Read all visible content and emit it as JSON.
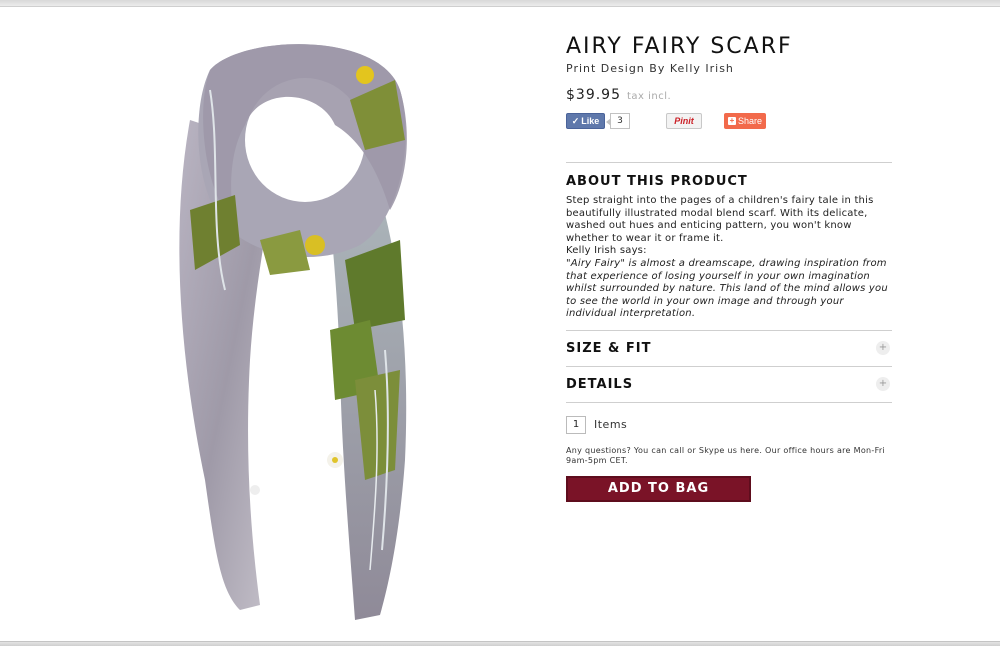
{
  "product": {
    "title": "AIRY FAIRY SCARF",
    "designer": "Print Design By Kelly Irish",
    "price": "$39.95",
    "tax_note": "tax incl."
  },
  "social": {
    "like_label": "Like",
    "like_count": "3",
    "pin_label": "Pinit",
    "share_label": "Share"
  },
  "about": {
    "heading": "ABOUT THIS PRODUCT",
    "description": "Step straight into the pages of a children's fairy tale in this beautifully illustrated modal blend scarf. With its delicate, washed out hues and enticing pattern, you won't know whether to wear it or frame it.",
    "says": "Kelly Irish says:",
    "quote": "\"Airy Fairy\" is almost a dreamscape, drawing inspiration from that experience of losing yourself in your own imagination whilst surrounded by nature. This land of the mind allows you to see the world in your own image and through your individual interpretation."
  },
  "accordions": {
    "size_fit": "SIZE & FIT",
    "details": "DETAILS"
  },
  "purchase": {
    "quantity": "1",
    "items_label": "Items",
    "questions": "Any questions? You can call or Skype us here. Our office hours are Mon-Fri 9am-5pm CET.",
    "add_to_bag": "ADD TO BAG"
  },
  "colors": {
    "add_to_bag_bg": "#7a1327",
    "facebook": "#5f78ab",
    "share": "#f26a4b",
    "pinterest": "#cb2027"
  }
}
